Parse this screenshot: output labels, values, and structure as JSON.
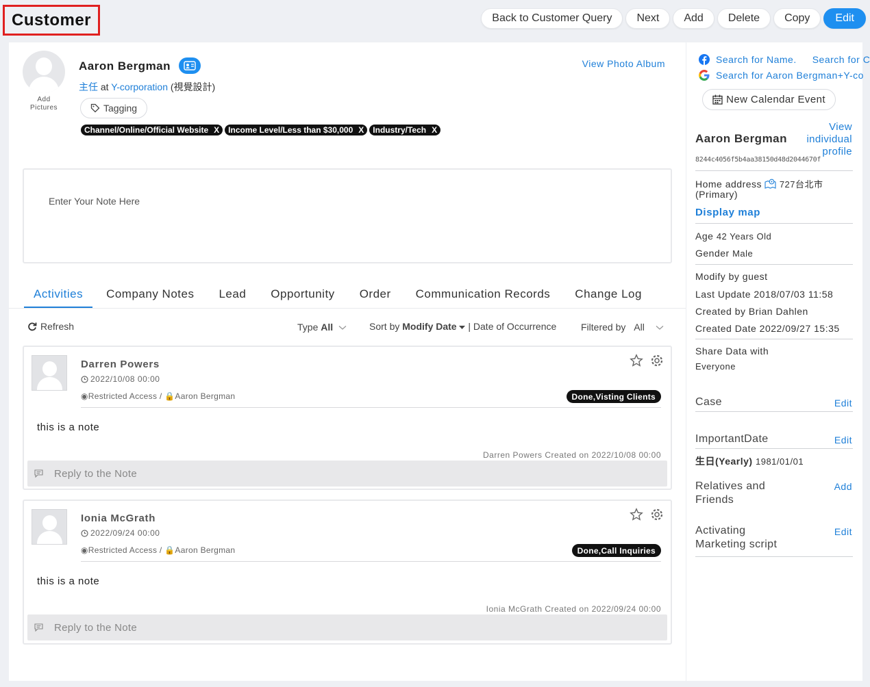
{
  "header": {
    "title": "Customer",
    "actions": [
      "Back to Customer Query",
      "Next",
      "Add",
      "Delete",
      "Copy",
      "Edit"
    ]
  },
  "profile": {
    "add_pictures": "Add Pictures",
    "name": "Aaron Bergman",
    "badge_icon": "person-card-icon",
    "job_title": "主任",
    "at": "at",
    "company": "Y-corporation",
    "department": "(視覺設計)",
    "view_album": "View Photo Album",
    "tagging_label": "Tagging",
    "tags": [
      "Channel/Online/Official Website",
      "Income Level/Less than $30,000",
      "Industry/Tech"
    ],
    "tag_remove": "X"
  },
  "note": {
    "placeholder": "Enter Your Note Here"
  },
  "tabs": [
    "Activities",
    "Company Notes",
    "Lead",
    "Opportunity",
    "Order",
    "Communication Records",
    "Change Log"
  ],
  "toolbar": {
    "refresh": "Refresh",
    "type_label": "Type",
    "type_value": "All",
    "sort_label": "Sort by",
    "sort_value": "Modify Date",
    "sort_separator": "|",
    "sort_alt": "Date of Occurrence",
    "filtered_label": "Filtered by",
    "filtered_value": "All"
  },
  "activities": [
    {
      "name": "Darren Powers",
      "date": "2022/10/08 00:00",
      "access": "Restricted Access /",
      "owner": "Aaron Bergman",
      "status": "Done,Visting Clients",
      "body": "this is a note",
      "created": "Darren Powers Created on 2022/10/08 00:00",
      "reply": "Reply to the Note"
    },
    {
      "name": "Ionia McGrath",
      "date": "2022/09/24 00:00",
      "access": "Restricted Access /",
      "owner": "Aaron Bergman",
      "status": "Done,Call Inquiries",
      "body": "this is a note",
      "created": "Ionia McGrath Created on 2022/09/24 00:00",
      "reply": "Reply to the Note"
    }
  ],
  "side": {
    "search_name": "Search for Name.",
    "search_company": "Search for C",
    "search_google": "Search for Aaron Bergman+Y-co",
    "new_event": "New Calendar Event",
    "name": "Aaron Bergman",
    "view_profile_lines": [
      "View",
      "individual",
      "profile"
    ],
    "id": "8244c4056f5b4aa38150d48d2044670f",
    "home_label": "Home address",
    "home_value": "727台北市",
    "primary": "(Primary)",
    "display_map": "Display map",
    "age_label": "Age",
    "age_value": "42 Years Old",
    "gender_label": "Gender",
    "gender_value": "Male",
    "modify_by": "Modify by guest",
    "last_update": "Last Update 2018/07/03 11:58",
    "created_by": "Created by Brian Dahlen",
    "created_date": "Created Date 2022/09/27 15:35",
    "share_label": "Share Data with",
    "share_value": "Everyone",
    "case_label": "Case",
    "important_label": "ImportantDate",
    "birthday_label": "生日(Yearly)",
    "birthday_value": "1981/01/01",
    "relatives_lines": [
      "Relatives and",
      "Friends"
    ],
    "marketing_lines": [
      "Activating",
      "Marketing script"
    ],
    "edit": "Edit",
    "add": "Add"
  }
}
